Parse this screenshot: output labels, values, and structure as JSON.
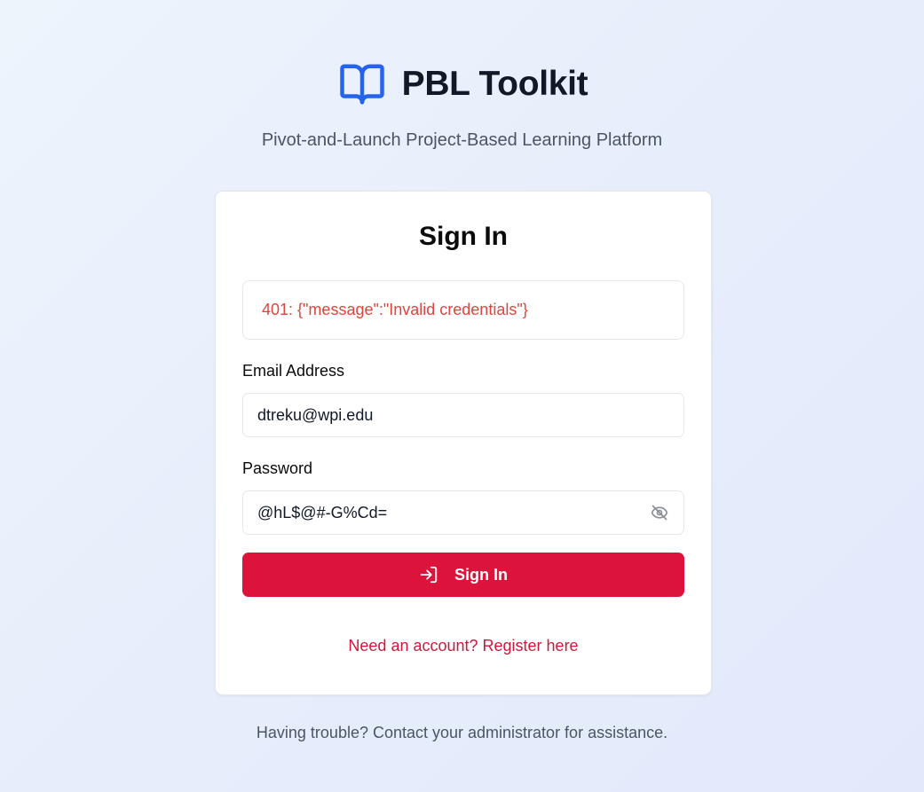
{
  "brand": {
    "logo_icon": "open-book-icon",
    "title": "PBL Toolkit",
    "tagline": "Pivot-and-Launch Project-Based Learning Platform"
  },
  "form": {
    "title": "Sign In",
    "error_message": "401: {\"message\":\"Invalid credentials\"}",
    "email_label": "Email Address",
    "email_value": "dtreku@wpi.edu",
    "password_label": "Password",
    "password_value": "@hL$@#-G%Cd=",
    "password_toggle_icon": "eye-off-icon",
    "submit_icon": "log-in-icon",
    "submit_label": "Sign In",
    "register_link": "Need an account? Register here"
  },
  "footer": {
    "help_text": "Having trouble? Contact your administrator for assistance."
  },
  "colors": {
    "brand_blue": "#2563eb",
    "primary_button": "#dc143c",
    "link": "#d0173b",
    "error_text": "#e0443c"
  }
}
